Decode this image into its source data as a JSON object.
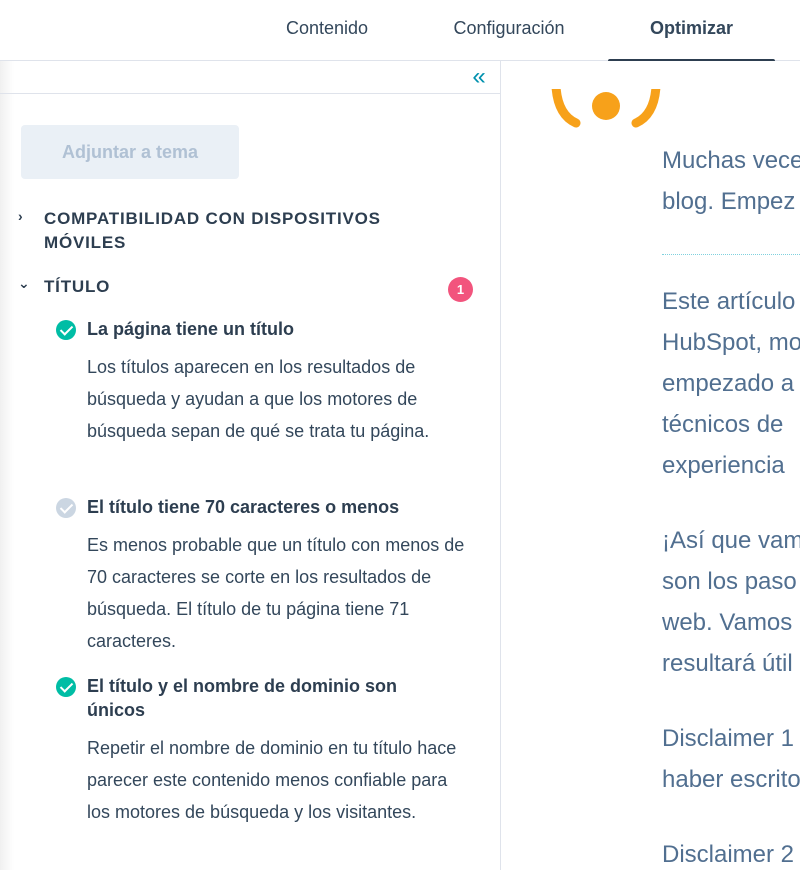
{
  "tabs": [
    {
      "label": "Contenido"
    },
    {
      "label": "Configuración"
    },
    {
      "label": "Optimizar"
    }
  ],
  "panel": {
    "collapse_icon": "double-chevron-left-icon",
    "attach_button": "Adjuntar a tema",
    "sections": {
      "mobile": {
        "label": "COMPATIBILIDAD CON DISPOSITIVOS MÓVILES",
        "expanded": false
      },
      "title": {
        "label": "TÍTULO",
        "expanded": true,
        "badge": "1"
      }
    },
    "items": [
      {
        "title": "La página tiene un título",
        "status": "pass",
        "desc": "Los títulos aparecen en los resultados de búsqueda y ayudan a que los motores de búsqueda sepan de qué se trata tu página."
      },
      {
        "title": "El título tiene 70 caracteres o menos",
        "status": "fail",
        "desc": "Es menos probable que un título con menos de 70 caracteres se corte en los resultados de búsqueda. El título de tu página tiene 71 caracteres."
      },
      {
        "title": "El título y el nombre de dominio son únicos",
        "status": "pass",
        "desc": "Repetir el nombre de dominio en tu título hace parecer este contenido menos confiable para los motores de búsqueda y los visitantes."
      }
    ]
  },
  "preview": {
    "paragraphs": [
      [
        "Muchas vece",
        "blog. Empez"
      ],
      [
        "Este artículo",
        "HubSpot, mo",
        "empezado a",
        "técnicos de",
        "experiencia"
      ],
      [
        "¡Así que vam",
        "son los paso",
        "web. Vamos",
        "resultará útil"
      ],
      [
        "Disclaimer 1",
        "haber escrito"
      ],
      [
        "Disclaimer 2"
      ]
    ]
  },
  "colors": {
    "accent": "#0091ae",
    "pass": "#00bda5",
    "fail": "#cbd6e2",
    "badge": "#f2547d",
    "logo": "#f7a11a"
  }
}
